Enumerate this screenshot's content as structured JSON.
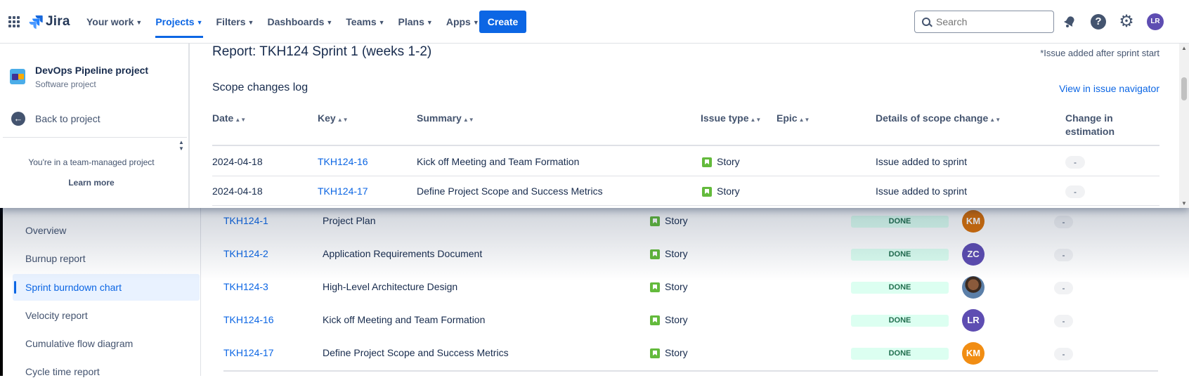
{
  "topbar": {
    "app_name": "Jira",
    "nav": [
      {
        "label": "Your work"
      },
      {
        "label": "Projects"
      },
      {
        "label": "Filters"
      },
      {
        "label": "Dashboards"
      },
      {
        "label": "Teams"
      },
      {
        "label": "Plans"
      },
      {
        "label": "Apps"
      }
    ],
    "active_nav": "Projects",
    "create_label": "Create",
    "search_placeholder": "Search",
    "help_glyph": "?",
    "settings_glyph": "⚙",
    "user_initials": "LR"
  },
  "sidebar": {
    "project_name": "DevOps Pipeline project",
    "project_type": "Software project",
    "back_label": "Back to project",
    "back_glyph": "←",
    "team_message": "You're in a team-managed project",
    "learn_more": "Learn more"
  },
  "report": {
    "title": "Report: TKH124 Sprint 1 (weeks 1-2)",
    "footnote": "*Issue added after sprint start",
    "scope_title": "Scope changes log",
    "view_link": "View in issue navigator",
    "columns": [
      {
        "label": "Date"
      },
      {
        "label": "Key"
      },
      {
        "label": "Summary"
      },
      {
        "label": "Issue type"
      },
      {
        "label": "Epic"
      },
      {
        "label": "Details of scope change"
      },
      {
        "label": "Change in estimation"
      }
    ],
    "rows": [
      {
        "date": "2024-04-18",
        "key": "TKH124-16",
        "summary": "Kick off Meeting and Team Formation",
        "type": "Story",
        "epic": "",
        "detail": "Issue added to sprint",
        "est": "-"
      },
      {
        "date": "2024-04-18",
        "key": "TKH124-17",
        "summary": "Define Project Scope and Success Metrics",
        "type": "Story",
        "epic": "",
        "detail": "Issue added to sprint",
        "est": "-"
      }
    ]
  },
  "background": {
    "nav_items": [
      {
        "label": "Overview"
      },
      {
        "label": "Burnup report"
      },
      {
        "label": "Sprint burndown chart"
      },
      {
        "label": "Velocity report"
      },
      {
        "label": "Cumulative flow diagram"
      },
      {
        "label": "Cycle time report"
      }
    ],
    "active_nav": "Sprint burndown chart",
    "issues": [
      {
        "key": "TKH124-1",
        "summary": "Project Plan",
        "type": "Story",
        "status": "DONE",
        "assignee": "KM",
        "avatar_color": "#d97008",
        "est": "-"
      },
      {
        "key": "TKH124-2",
        "summary": "Application Requirements Document",
        "type": "Story",
        "status": "DONE",
        "assignee": "ZC",
        "avatar_color": "#5e4db2",
        "est": "-"
      },
      {
        "key": "TKH124-3",
        "summary": "High-Level Architecture Design",
        "type": "Story",
        "status": "DONE",
        "assignee": "",
        "avatar_color": "#6b4a2f",
        "est": "-"
      },
      {
        "key": "TKH124-16",
        "summary": "Kick off Meeting and Team Formation",
        "type": "Story",
        "status": "DONE",
        "assignee": "LR",
        "avatar_color": "#5e4db2",
        "est": "-"
      },
      {
        "key": "TKH124-17",
        "summary": "Define Project Scope and Success Metrics",
        "type": "Story",
        "status": "DONE",
        "assignee": "KM",
        "avatar_color": "#f18d13",
        "est": "-"
      }
    ]
  },
  "colors": {
    "accent": "#0c66e4",
    "story_green": "#63ba3c",
    "done_bg": "#dcfff1",
    "done_text": "#216e4e"
  }
}
